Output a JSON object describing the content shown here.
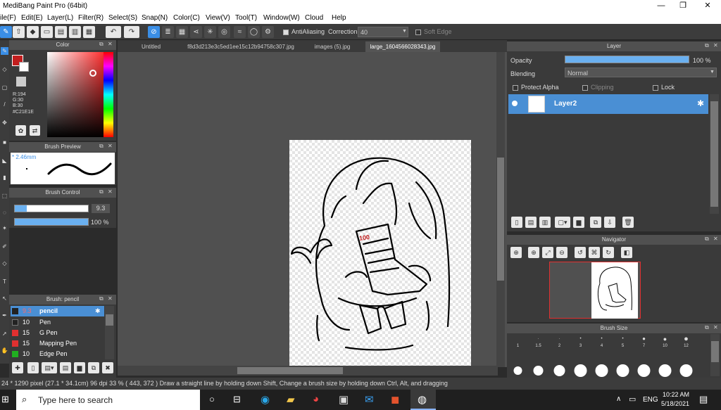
{
  "window": {
    "title": "MediBang Paint Pro (64bit)"
  },
  "menu": [
    "ile(F)",
    "Edit(E)",
    "Layer(L)",
    "Filter(R)",
    "Select(S)",
    "Snap(N)",
    "Color(C)",
    "View(V)",
    "Tool(T)",
    "Window(W)",
    "Cloud",
    "Help"
  ],
  "toolbar": {
    "antialiasing_label": "AntiAliasing",
    "correction_label": "Correction",
    "correction_value": "40",
    "soft_edge_label": "Soft Edge"
  },
  "color_panel": {
    "title": "Color",
    "r": "R:194",
    "g": "G:30",
    "b": "B:30",
    "hex": "#C21E1E",
    "fg": "#c21e1e"
  },
  "brush_preview": {
    "title": "Brush Preview",
    "size": "* 2.46mm"
  },
  "brush_control": {
    "title": "Brush Control",
    "size_value": "9.3",
    "opacity_value": "100 %"
  },
  "brush_list": {
    "title": "Brush: pencil",
    "items": [
      {
        "size": "9.3",
        "name": "pencil",
        "color": "#222222"
      },
      {
        "size": "10",
        "name": "Pen",
        "color": "#222222"
      },
      {
        "size": "15",
        "name": "G Pen",
        "color": "#e03030"
      },
      {
        "size": "15",
        "name": "Mapping Pen",
        "color": "#e03030"
      },
      {
        "size": "10",
        "name": "Edge Pen",
        "color": "#20b020"
      }
    ]
  },
  "tabs": [
    "Untitled",
    "f8d3d213e3c5ed1ee15c12b94758c307.jpg",
    "images (5).jpg",
    "large_1604566028343.jpg"
  ],
  "layer_panel": {
    "title": "Layer",
    "opacity_label": "Opacity",
    "opacity_value": "100 %",
    "opacity_fraction": 1.0,
    "blending_label": "Blending",
    "blending_value": "Normal",
    "protect_alpha": "Protect Alpha",
    "clipping": "Clipping",
    "lock": "Lock",
    "layer_name": "Layer2"
  },
  "navigator": {
    "title": "Navigator"
  },
  "brush_size": {
    "title": "Brush Size",
    "sizes": [
      "1",
      "1.5",
      "2",
      "3",
      "4",
      "5",
      "7",
      "10",
      "12"
    ]
  },
  "annotation": {
    "text": "100"
  },
  "status": {
    "text": "24 * 1290 pixel  (27.1 * 34.1cm)  96 dpi  33 %  ( 443, 372 )  Draw a straight line by holding down Shift, Change a brush size by holding down Ctrl, Alt, and dragging"
  },
  "taskbar": {
    "search_placeholder": "Type here to search",
    "lang": "ENG",
    "time": "10:22 AM",
    "date": "5/18/2021"
  }
}
